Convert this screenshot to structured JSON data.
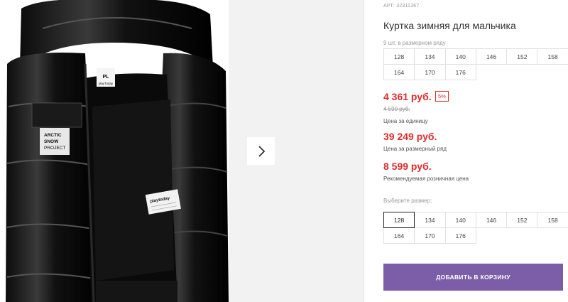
{
  "product": {
    "article": "АРТ: 32311367",
    "title": "Куртка зимняя для мальчика"
  },
  "size_set": {
    "note": "9 шт. в размерном ряду",
    "sizes": [
      "128",
      "134",
      "140",
      "146",
      "152",
      "158",
      "164",
      "170",
      "176"
    ]
  },
  "pricing": {
    "unit_price": "4 361 руб.",
    "discount": "5%",
    "old_price": "4 590 руб.",
    "unit_caption": "Цена за единицу",
    "set_price": "39 249 руб.",
    "set_caption": "Цена за размерный ряд",
    "rrp": "8 599 руб.",
    "rrp_caption": "Рекомендуемая розничная цена"
  },
  "size_picker": {
    "label": "Выберите размер:",
    "sizes": [
      "128",
      "134",
      "140",
      "146",
      "152",
      "158",
      "164",
      "170",
      "176"
    ],
    "selected": "128"
  },
  "cart": {
    "button_label": "ДОБАВИТЬ В КОРЗИНУ"
  },
  "image": {
    "patch_lines": [
      "ARCTIC",
      "SNOW",
      "PROJECT"
    ],
    "label_text": "playToday",
    "tag_text": "playtoday"
  },
  "colors": {
    "price_red": "#e02b2b",
    "button_purple": "#7b5ea7"
  },
  "icons": {
    "next": "chevron-right-icon"
  }
}
